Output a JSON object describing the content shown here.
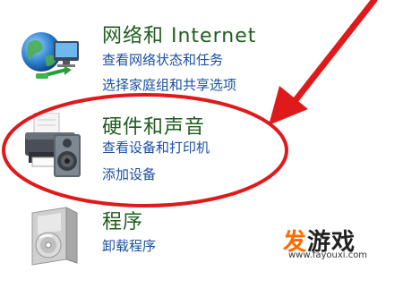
{
  "categories": [
    {
      "title": "网络和 Internet",
      "icon": "network-globe-icon",
      "links": [
        "查看网络状态和任务",
        "选择家庭组和共享选项"
      ]
    },
    {
      "title": "硬件和声音",
      "icon": "printer-speaker-icon",
      "links": [
        "查看设备和打印机",
        "添加设备"
      ]
    },
    {
      "title": "程序",
      "icon": "programs-box-icon",
      "links": [
        "卸载程序"
      ]
    }
  ],
  "colors": {
    "title": "#1e5e1e",
    "link": "#1a4fa3",
    "annotation": "#e01a1a",
    "watermark": "#ff6a00"
  },
  "watermark": {
    "brand_first": "发",
    "brand_rest": "游戏",
    "url": "www.fayouxi.com"
  }
}
